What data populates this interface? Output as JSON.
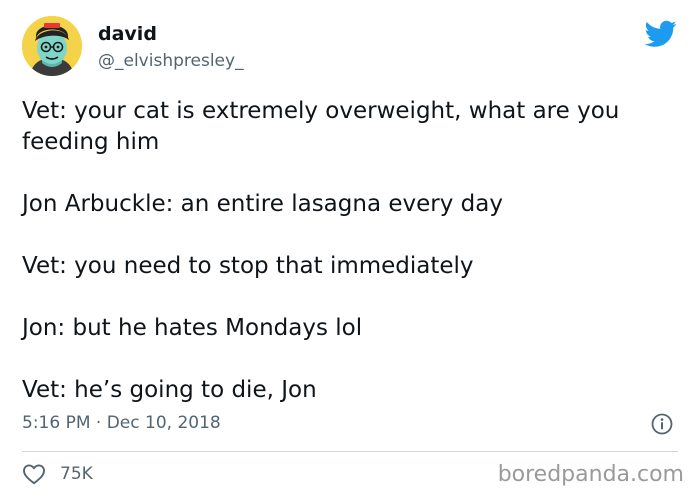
{
  "tweet": {
    "display_name": "david",
    "handle": "@_elvishpresley_",
    "lines": [
      "Vet: your cat is extremely overweight, what are you feeding him",
      "Jon Arbuckle: an entire lasagna every day",
      "Vet: you need to stop that immediately",
      "Jon: but he hates Mondays lol",
      "Vet: he’s going to die, Jon"
    ],
    "timestamp": "5:16 PM · Dec 10, 2018",
    "like_count": "75K"
  },
  "icons": {
    "avatar": "avatar-illustration",
    "brand": "twitter-bird-icon",
    "info": "info-icon",
    "like": "heart-icon"
  },
  "colors": {
    "twitter_blue": "#1d9bf0",
    "secondary_text": "#536471",
    "divider": "#cfd9de",
    "watermark": "#9a9a9a"
  },
  "watermark": "boredpanda.com"
}
